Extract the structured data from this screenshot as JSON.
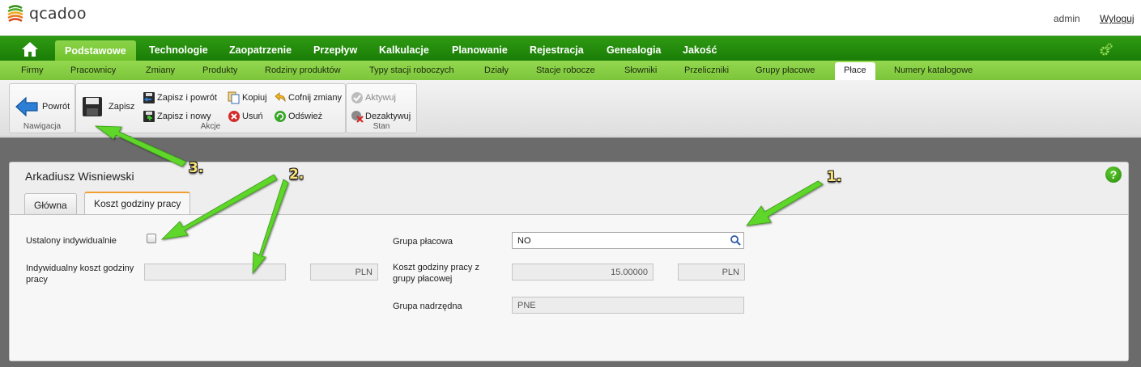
{
  "header": {
    "logo_text": "qcadoo",
    "user": "admin",
    "logout_label": "Wyloguj"
  },
  "main_nav": {
    "items": [
      "Podstawowe",
      "Technologie",
      "Zaopatrzenie",
      "Przepływ",
      "Kalkulacje",
      "Planowanie",
      "Rejestracja",
      "Genealogia",
      "Jakość"
    ],
    "active": "Podstawowe"
  },
  "sub_nav": {
    "items": [
      "Firmy",
      "Pracownicy",
      "Zmiany",
      "Produkty",
      "Rodziny produktów",
      "Typy stacji roboczych",
      "Działy",
      "Stacje robocze",
      "Słowniki",
      "Przeliczniki",
      "Grupy płacowe",
      "Płace",
      "Numery katalogowe"
    ],
    "active": "Płace"
  },
  "ribbon": {
    "navigation": {
      "label": "Nawigacja",
      "back": "Powrót"
    },
    "actions": {
      "label": "Akcje",
      "save": "Zapisz",
      "save_and_back": "Zapisz i powrót",
      "save_and_new": "Zapisz i nowy",
      "copy": "Kopiuj",
      "delete": "Usuń",
      "undo": "Cofnij zmiany",
      "refresh": "Odśwież"
    },
    "state": {
      "label": "Stan",
      "activate": "Aktywuj",
      "deactivate": "Dezaktywuj"
    }
  },
  "form": {
    "title": "Arkadiusz Wisniewski",
    "tabs": [
      "Główna",
      "Koszt godziny pracy"
    ],
    "active_tab": "Koszt godziny pracy",
    "individual_fixed_label": "Ustalony indywidualnie",
    "individual_fixed_checked": false,
    "individual_cost_label_1": "Indywidualny koszt godziny",
    "individual_cost_label_2": "pracy",
    "individual_cost_value": "",
    "individual_cost_currency": "PLN",
    "wage_group_label": "Grupa płacowa",
    "wage_group_value": "NO",
    "group_cost_label_1": "Koszt godziny pracy z",
    "group_cost_label_2": "grupy płacowej",
    "group_cost_value": "15.00000",
    "group_cost_currency": "PLN",
    "parent_group_label": "Grupa nadrzędna",
    "parent_group_value": "PNE"
  },
  "annotations": {
    "marker_1": "1.",
    "marker_2": "2.",
    "marker_3": "3.",
    "arrow_color": "#5fd62a"
  }
}
